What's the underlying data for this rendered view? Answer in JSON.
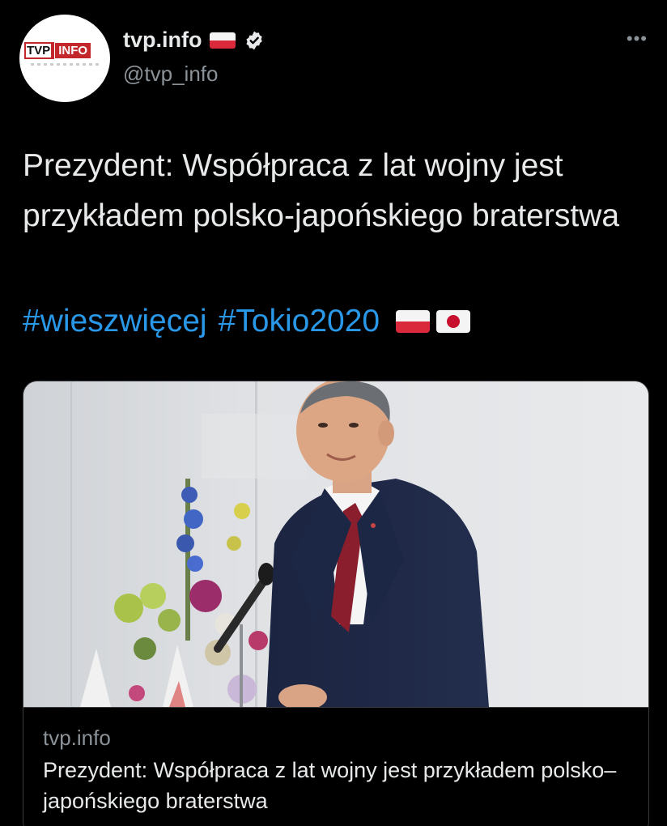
{
  "account": {
    "display_name": "tvp.info",
    "handle": "@tvp_info",
    "avatar_logo_left": "TVP",
    "avatar_logo_right": "INFO"
  },
  "tweet": {
    "text": "Prezydent: Współpraca z lat wojny jest przykładem polsko-japońskiego braterstwa",
    "hashtags": [
      "#wieszwięcej",
      "#Tokio2020"
    ]
  },
  "card": {
    "domain": "tvp.info",
    "title": "Prezydent: Współpraca z lat wojny jest przykładem polsko–japońskiego braterstwa"
  },
  "icons": {
    "more": "more-icon",
    "verified": "verified-icon",
    "flags": [
      "poland-flag-icon",
      "japan-flag-icon"
    ]
  },
  "colors": {
    "background": "#000000",
    "hashtag": "#2a98e8",
    "secondary_text": "#8b9298",
    "logo_red": "#c3262b"
  }
}
